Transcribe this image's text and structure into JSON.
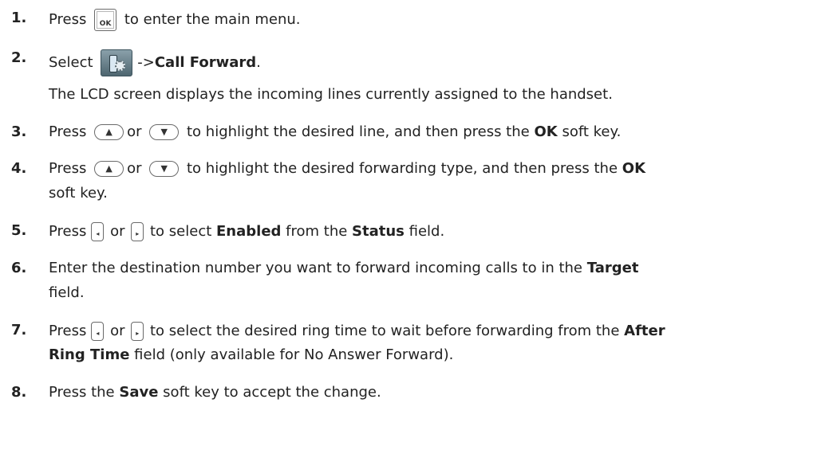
{
  "steps": [
    {
      "num": "1.",
      "pre": "Press",
      "key": "OK",
      "post": "to enter the main menu."
    },
    {
      "num": "2.",
      "pre": "Select",
      "arrow": "->",
      "bold": "Call Forward",
      "post": "."
    },
    {
      "text": "The LCD screen displays the incoming lines currently assigned to the handset."
    },
    {
      "num": "3.",
      "pre": "Press",
      "or": "or",
      "post1": "to highlight the desired line, and then press the",
      "bold": "OK",
      "post2": "soft key."
    },
    {
      "num": "4.",
      "pre": "Press",
      "or": "or",
      "post1": "to highlight the desired forwarding type, and then press the",
      "bold": "OK",
      "cont": "soft key."
    },
    {
      "num": "5.",
      "pre": "Press",
      "or": "or",
      "mid": "to select",
      "bold1": "Enabled",
      "mid2": "from the",
      "bold2": "Status",
      "post": "field."
    },
    {
      "num": "6.",
      "line1": "Enter the destination number you want to forward incoming calls to in the",
      "bold": "Target",
      "cont": "field."
    },
    {
      "num": "7.",
      "pre": "Press",
      "or": "or",
      "mid": "to select the desired ring time to wait before forwarding from the",
      "bold1": "After",
      "bold2": "Ring Time",
      "cont": "field (only available for No Answer Forward)."
    },
    {
      "num": "8.",
      "pre": "Press the",
      "bold": "Save",
      "post": "soft key to accept the change."
    }
  ],
  "icons": {
    "ok_key": "ok-key-icon",
    "menu": "settings-menu-icon",
    "up": "up-arrow-key-icon",
    "down": "down-arrow-key-icon",
    "left": "left-key-icon",
    "right": "right-key-icon"
  },
  "glyphs": {
    "up": "▲",
    "down": "▼",
    "left": "◂",
    "right": "▸"
  }
}
